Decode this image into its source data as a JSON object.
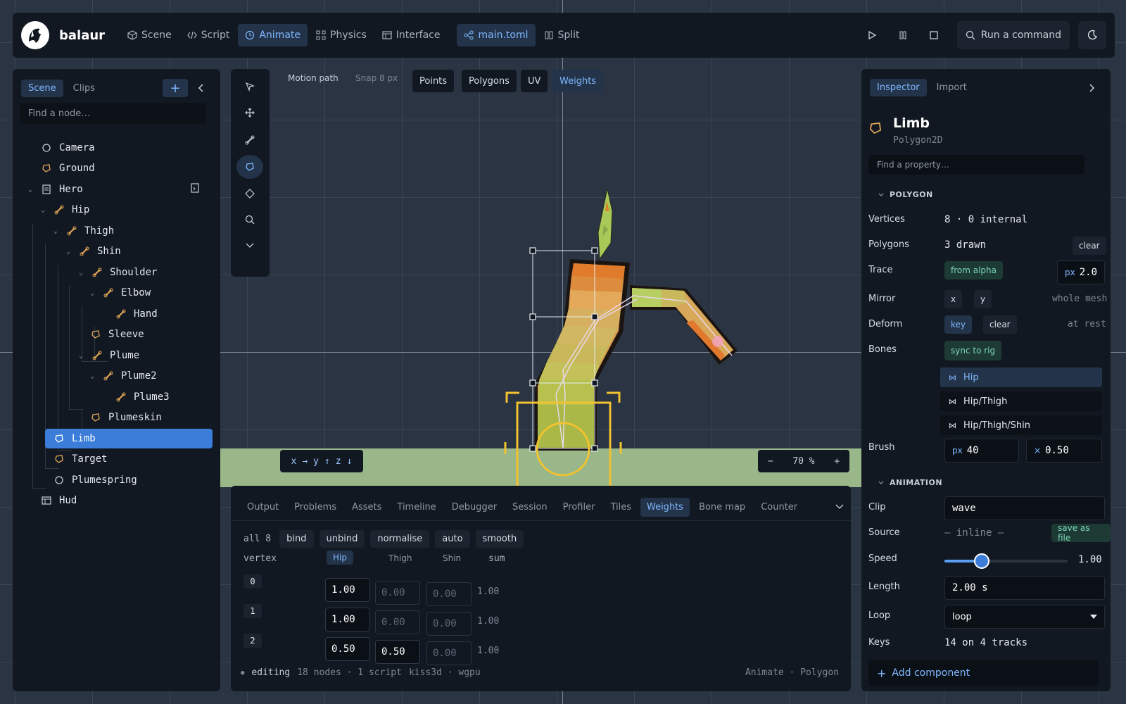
{
  "app": {
    "name": "balaur"
  },
  "nav": {
    "scene": "Scene",
    "script": "Script",
    "animate": "Animate",
    "physics": "Physics",
    "interface": "Interface",
    "file": "main.toml",
    "split": "Split"
  },
  "command": {
    "label": "Run a command"
  },
  "left": {
    "tabs": [
      "Scene",
      "Clips"
    ],
    "search_placeholder": "Find a node…",
    "tree": [
      {
        "label": "Camera",
        "icon": "circle-icon"
      },
      {
        "label": "Ground",
        "icon": "polygon-icon"
      },
      {
        "label": "Hero",
        "icon": "scene-file-icon",
        "expanded": true
      },
      {
        "label": "Hip",
        "icon": "bone-icon",
        "expanded": true
      },
      {
        "label": "Thigh",
        "icon": "bone-icon",
        "expanded": true
      },
      {
        "label": "Shin",
        "icon": "bone-icon",
        "expanded": true
      },
      {
        "label": "Shoulder",
        "icon": "bone-icon",
        "expanded": true
      },
      {
        "label": "Elbow",
        "icon": "bone-icon",
        "expanded": true
      },
      {
        "label": "Hand",
        "icon": "bone-icon"
      },
      {
        "label": "Sleeve",
        "icon": "polygon-icon"
      },
      {
        "label": "Plume",
        "icon": "bone-icon",
        "expanded": true
      },
      {
        "label": "Plume2",
        "icon": "bone-icon",
        "expanded": true
      },
      {
        "label": "Plume3",
        "icon": "bone-icon"
      },
      {
        "label": "Plumeskin",
        "icon": "polygon-icon"
      },
      {
        "label": "Limb",
        "icon": "polygon-icon",
        "selected": true
      },
      {
        "label": "Target",
        "icon": "polygon-icon"
      },
      {
        "label": "Plumespring",
        "icon": "circle-icon"
      },
      {
        "label": "Hud",
        "icon": "ui-layout-icon"
      }
    ]
  },
  "viewport": {
    "motion_path": "Motion path",
    "snap": "Snap 8 px",
    "modes": [
      "Points",
      "Polygons",
      "UV",
      "Weights"
    ],
    "active_mode": "Weights",
    "axes": {
      "x": "x",
      "x_arrow": "→",
      "y": "y",
      "y_arrow": "↑",
      "z": "z",
      "z_arrow": "↓"
    },
    "zoom": {
      "minus": "−",
      "value": "70 %",
      "plus": "+"
    }
  },
  "bottom": {
    "tabs": [
      "Output",
      "Problems",
      "Assets",
      "Timeline",
      "Debugger",
      "Session",
      "Profiler",
      "Tiles",
      "Weights",
      "Bone map",
      "Counter"
    ],
    "active_tab": "Weights",
    "count": "all 8",
    "actions": [
      "bind",
      "unbind",
      "normalise",
      "auto",
      "smooth"
    ],
    "columns": {
      "vertex": "vertex",
      "hip": "Hip",
      "thigh": "Thigh",
      "shin": "Shin",
      "sum": "sum"
    },
    "rows": [
      {
        "idx": "0",
        "hip": "1.00",
        "thigh": "0.00",
        "shin": "0.00",
        "sum": "1.00"
      },
      {
        "idx": "1",
        "hip": "1.00",
        "thigh": "0.00",
        "shin": "0.00",
        "sum": "1.00"
      },
      {
        "idx": "2",
        "hip": "0.50",
        "thigh": "0.50",
        "shin": "0.00",
        "sum": "1.00"
      }
    ],
    "status": {
      "bullet": "●",
      "mode": "editing",
      "stats": "18 nodes · 1 script",
      "backend": "kiss3d · wgpu",
      "right": "Animate · Polygon"
    }
  },
  "inspector": {
    "tabs": [
      "Inspector",
      "Import"
    ],
    "title": "Limb",
    "type": "Polygon2D",
    "search_placeholder": "Find a property…",
    "polygon_section": "POLYGON",
    "vertices_label": "Vertices",
    "vertices_value": "8 · 0 internal",
    "polygons_label": "Polygons",
    "polygons_value": "3 drawn",
    "polygons_clear": "clear",
    "trace_label": "Trace",
    "trace_btn": "from alpha",
    "trace_unit": "px",
    "trace_value": "2.0",
    "mirror_label": "Mirror",
    "mirror_x": "x",
    "mirror_y": "y",
    "mirror_note": "whole mesh",
    "deform_label": "Deform",
    "deform_key": "key",
    "deform_clear": "clear",
    "deform_note": "at rest",
    "bones_label": "Bones",
    "bones_sync": "sync to rig",
    "bones": [
      "Hip",
      "Hip/Thigh",
      "Hip/Thigh/Shin"
    ],
    "brush_label": "Brush",
    "brush_unit": "px",
    "brush_size": "40",
    "brush_mult": "×",
    "brush_strength": "0.50",
    "animation_section": "ANIMATION",
    "clip_label": "Clip",
    "clip_value": "wave",
    "source_label": "Source",
    "source_value": "— inline —",
    "source_btn": "save as file",
    "speed_label": "Speed",
    "speed_value": "1.00",
    "speed_fraction": 0.3,
    "length_label": "Length",
    "length_value": "2.00 s",
    "loop_label": "Loop",
    "loop_value": "loop",
    "keys_label": "Keys",
    "keys_value": "14 on 4 tracks",
    "add_component": "Add component"
  },
  "colors": {
    "accent": "#3b7dd8",
    "accent_text": "#7fb6ff",
    "ground": "#9ab78a",
    "panel": "#121821",
    "gizmo": "#f2c230"
  }
}
